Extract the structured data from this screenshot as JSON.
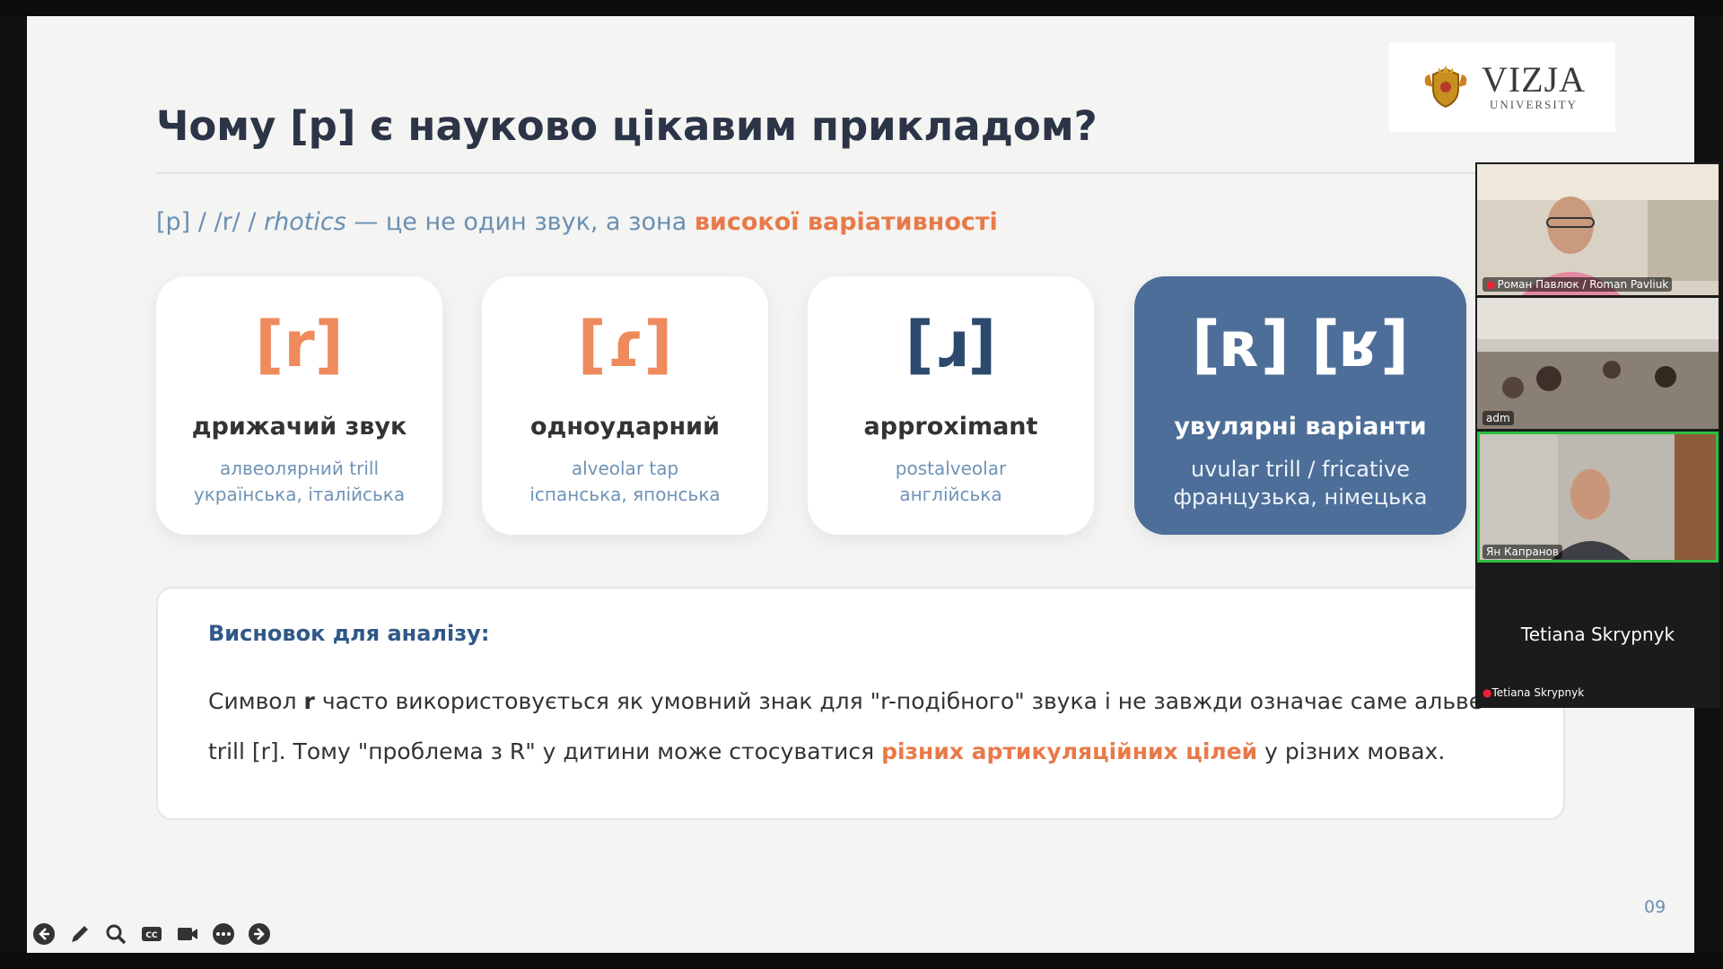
{
  "slide": {
    "title": "Чому [р] є науково цікавим прикладом?",
    "subtitle": {
      "part1": "[р] / /r/ / ",
      "italic": "rhotics",
      "part2": " — це не один звук, а зона ",
      "highlight": "високої варіативності"
    },
    "logo": {
      "word": "VIZJA",
      "sub": "UNIVERSITY"
    },
    "cards": [
      {
        "symbol": "[r]",
        "name": "дрижачий звук",
        "desc1": "алвеолярний trill",
        "desc2": "українська, італійська"
      },
      {
        "symbol": "[ɾ]",
        "name": "одноударний",
        "desc1": "alveolar tap",
        "desc2": "іспанська, японська"
      },
      {
        "symbol": "[ɹ]",
        "name": "approximant",
        "desc1": "postalveolar",
        "desc2": "англійська"
      },
      {
        "symbol": "[ʀ] [ʁ]",
        "name": "увулярні варіанти",
        "desc1": "uvular trill / fricative",
        "desc2": "французька, німецька"
      }
    ],
    "conclusion": {
      "heading": "Висновок для аналізу:",
      "body1": "Символ ",
      "bold": "r",
      "body2": " часто використовується як умовний знак для \"r-подібного\" звука і не завжди означає саме альвеолярн",
      "body3": "trill [r]. Тому \"проблема з R\" у дитини може стосуватися ",
      "highlight": "різних артикуляційних цілей",
      "body4": " у різних мовах."
    },
    "page_number": "09"
  },
  "participants": [
    {
      "label": "Роман Павлюк / Roman Pavliuk"
    },
    {
      "label": "adm"
    },
    {
      "label": "Ян Капранов"
    },
    {
      "name": "Tetiana Skrypnyk",
      "label": "Tetiana Skrypnyk"
    }
  ],
  "controls": [
    "arrow-left-icon",
    "pen-icon",
    "search-icon",
    "cc-icon",
    "camera-icon",
    "more-icon",
    "arrow-right-icon"
  ],
  "colors": {
    "accent_orange": "#e87a4a",
    "accent_blue": "#4c6e98",
    "title": "#2c3447"
  }
}
